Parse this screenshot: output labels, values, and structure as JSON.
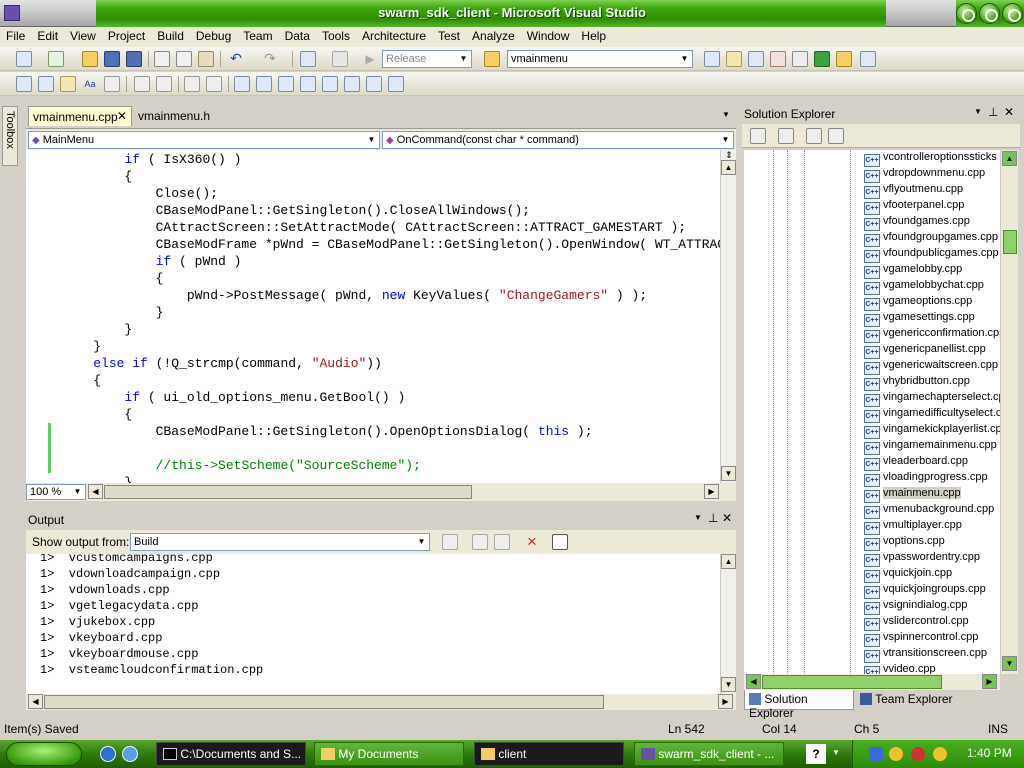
{
  "window": {
    "title": "swarm_sdk_client - Microsoft Visual Studio"
  },
  "menu": [
    "File",
    "Edit",
    "View",
    "Project",
    "Build",
    "Debug",
    "Team",
    "Data",
    "Tools",
    "Architecture",
    "Test",
    "Analyze",
    "Window",
    "Help"
  ],
  "toolbar": {
    "config_value": "Release",
    "find_value": "vmainmenu"
  },
  "toolbox": {
    "label": "Toolbox"
  },
  "editor": {
    "tabs": [
      {
        "label": "vmainmenu.cpp",
        "active": true
      },
      {
        "label": "vmainmenu.h",
        "active": false
      }
    ],
    "class_nav": "MainMenu",
    "member_nav": "OnCommand(const char * command)",
    "zoom": "100 %",
    "code_lines": [
      "        if ( IsX360() )",
      "        {",
      "            Close();",
      "            CBaseModPanel::GetSingleton().CloseAllWindows();",
      "            CAttractScreen::SetAttractMode( CAttractScreen::ATTRACT_GAMESTART );",
      "            CBaseModFrame *pWnd = CBaseModPanel::GetSingleton().OpenWindow( WT_ATTRACTSCREEN, NULL );",
      "            if ( pWnd )",
      "            {",
      "                pWnd->PostMessage( pWnd, new KeyValues( \"ChangeGamers\" ) );",
      "            }",
      "        }",
      "    }",
      "    else if (!Q_strcmp(command, \"Audio\"))",
      "    {",
      "        if ( ui_old_options_menu.GetBool() )",
      "        {",
      "            CBaseModPanel::GetSingleton().OpenOptionsDialog( this );",
      "",
      "            //this->SetScheme(\"SourceScheme\");",
      "        }"
    ]
  },
  "output": {
    "title": "Output",
    "show_from_label": "Show output from:",
    "show_from_value": "Build",
    "lines": [
      "1>  vcustomcampaigns.cpp",
      "1>  vdownloadcampaign.cpp",
      "1>  vdownloads.cpp",
      "1>  vgetlegacydata.cpp",
      "1>  vjukebox.cpp",
      "1>  vkeyboard.cpp",
      "1>  vkeyboardmouse.cpp",
      "1>  vsteamcloudconfirmation.cpp"
    ]
  },
  "solution_explorer": {
    "title": "Solution Explorer",
    "files": [
      "vcontrolleroptionssticks",
      "vdropdownmenu.cpp",
      "vflyoutmenu.cpp",
      "vfooterpanel.cpp",
      "vfoundgames.cpp",
      "vfoundgroupgames.cpp",
      "vfoundpublicgames.cpp",
      "vgamelobby.cpp",
      "vgamelobbychat.cpp",
      "vgameoptions.cpp",
      "vgamesettings.cpp",
      "vgenericconfirmation.cpp",
      "vgenericpanellist.cpp",
      "vgenericwaitscreen.cpp",
      "vhybridbutton.cpp",
      "vingamechapterselect.cpp",
      "vingamedifficultyselect.cpp",
      "vingamekickplayerlist.cpp",
      "vingamemainmenu.cpp",
      "vleaderboard.cpp",
      "vloadingprogress.cpp",
      "vmainmenu.cpp",
      "vmenubackground.cpp",
      "vmultiplayer.cpp",
      "voptions.cpp",
      "vpasswordentry.cpp",
      "vquickjoin.cpp",
      "vquickjoingroups.cpp",
      "vsignindialog.cpp",
      "vslidercontrol.cpp",
      "vspinnercontrol.cpp",
      "vtransitionscreen.cpp",
      "vvideo.cpp"
    ],
    "selected": "vmainmenu.cpp",
    "icon_text": "C++",
    "tabs": [
      "Solution Explorer",
      "Team Explorer"
    ]
  },
  "status": {
    "message": "Item(s) Saved",
    "ln": "Ln 542",
    "col": "Col 14",
    "ch": "Ch 5",
    "mode": "INS"
  },
  "taskbar": {
    "tasks": [
      "C:\\Documents and S...",
      "My Documents",
      "client",
      "swarm_sdk_client - ..."
    ],
    "time": "1:40 PM"
  }
}
